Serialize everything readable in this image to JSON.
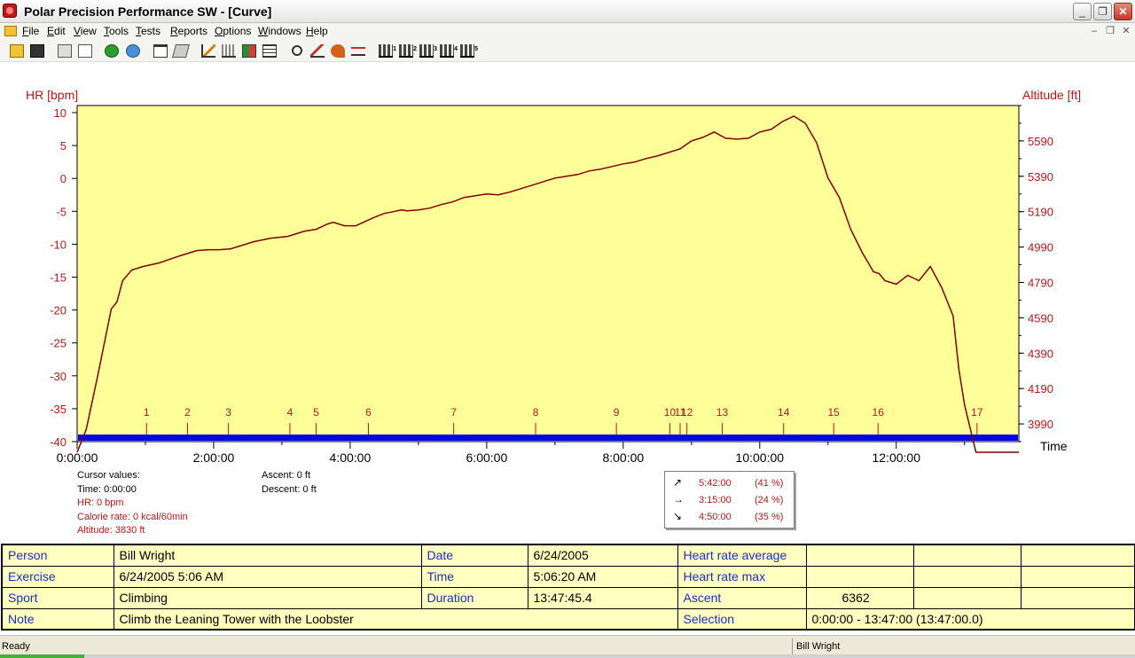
{
  "window": {
    "title": "Polar Precision Performance SW - [Curve]",
    "buttons": {
      "minimize": "_",
      "restore": "❐",
      "close": "✕"
    }
  },
  "menu": {
    "items": [
      "File",
      "Edit",
      "View",
      "Tools",
      "Tests",
      "Reports",
      "Options",
      "Windows",
      "Help"
    ],
    "mdi": {
      "minimize": "–",
      "restore": "❐",
      "close": "✕"
    }
  },
  "toolbar": {
    "icons": [
      "open-icon",
      "save-icon",
      "print-icon",
      "copy-icon",
      "refresh-icon",
      "globe-icon",
      "window-icon",
      "book-icon",
      "curve-icon",
      "bars-icon",
      "mixed-chart-icon",
      "table-icon",
      "zoom-icon",
      "chart-icon",
      "arrow-icon",
      "wave-icon",
      "bar-chart-1-icon",
      "bar-chart-2-icon",
      "bar-chart-3-icon",
      "bar-chart-4-icon",
      "bar-chart-5-icon"
    ],
    "bar_numbers": [
      "1",
      "2",
      "3",
      "4",
      "5"
    ]
  },
  "chart_data": {
    "type": "line",
    "left_axis_title": "HR [bpm]",
    "right_axis_title": "Altitude [ft]",
    "x_axis_title": "Time",
    "left_ticks": [
      "10",
      "5",
      "0",
      "-5",
      "-10",
      "-15",
      "-20",
      "-25",
      "-30",
      "-35",
      "-40"
    ],
    "right_ticks": [
      "5590",
      "5390",
      "5190",
      "4990",
      "4790",
      "4590",
      "4390",
      "4190",
      "3990"
    ],
    "x_ticks": [
      "0:00:00",
      "2:00:00",
      "4:00:00",
      "6:00:00",
      "8:00:00",
      "10:00:00",
      "12:00:00"
    ],
    "xlim_minutes": [
      0,
      827.75
    ],
    "altitude_ylim_ft": [
      3890,
      5790
    ],
    "background_color": "#ffff99",
    "line_color": "#800000",
    "series": [
      {
        "minutes": [
          0,
          8,
          18,
          30,
          35,
          40,
          48,
          58,
          72,
          90,
          105,
          115,
          125,
          135,
          145,
          155,
          170,
          185,
          200,
          210,
          220,
          225,
          230,
          235,
          245,
          255,
          262,
          270,
          278,
          285,
          290,
          300,
          310,
          320,
          330,
          340,
          350,
          360,
          370,
          380,
          390,
          400,
          410,
          420,
          430,
          440,
          450,
          460,
          470,
          480,
          490,
          500,
          510,
          520,
          530,
          540,
          550,
          560,
          570,
          580,
          590,
          600,
          610,
          620,
          630,
          640,
          650,
          660,
          670,
          680,
          690,
          700,
          705,
          710,
          720,
          730,
          740,
          750,
          760,
          770,
          775,
          780,
          790,
          800,
          810,
          820,
          827.75
        ],
        "values": [
          3830,
          3960,
          4260,
          4640,
          4680,
          4800,
          4860,
          4880,
          4900,
          4940,
          4970,
          4975,
          4975,
          4980,
          5000,
          5020,
          5040,
          5050,
          5080,
          5090,
          5120,
          5130,
          5120,
          5110,
          5110,
          5140,
          5160,
          5180,
          5190,
          5200,
          5195,
          5200,
          5210,
          5230,
          5245,
          5270,
          5280,
          5290,
          5285,
          5300,
          5320,
          5340,
          5360,
          5380,
          5390,
          5400,
          5420,
          5430,
          5445,
          5460,
          5470,
          5490,
          5505,
          5525,
          5545,
          5590,
          5610,
          5640,
          5605,
          5600,
          5605,
          5640,
          5655,
          5700,
          5730,
          5690,
          5580,
          5380,
          5270,
          5090,
          4960,
          4850,
          4840,
          4800,
          4780,
          4830,
          4800,
          4880,
          4760,
          4600,
          4300,
          4100,
          3830,
          3830,
          3830,
          3830,
          3830
        ]
      }
    ],
    "lap_markers": [
      {
        "label": "1",
        "minute": 61
      },
      {
        "label": "2",
        "minute": 97
      },
      {
        "label": "3",
        "minute": 133
      },
      {
        "label": "4",
        "minute": 187
      },
      {
        "label": "5",
        "minute": 210
      },
      {
        "label": "6",
        "minute": 256
      },
      {
        "label": "7",
        "minute": 331
      },
      {
        "label": "8",
        "minute": 403
      },
      {
        "label": "9",
        "minute": 474
      },
      {
        "label": "10",
        "minute": 521
      },
      {
        "label": "11",
        "minute": 530
      },
      {
        "label": "12",
        "minute": 536
      },
      {
        "label": "13",
        "minute": 567
      },
      {
        "label": "14",
        "minute": 621
      },
      {
        "label": "15",
        "minute": 665
      },
      {
        "label": "16",
        "minute": 704
      },
      {
        "label": "17",
        "minute": 791
      }
    ]
  },
  "cursor": {
    "heading": "Cursor values:",
    "time": "Time: 0:00:00",
    "hr": "HR: 0 bpm",
    "calorie": "Calorie rate: 0 kcal/60min",
    "altitude": "Altitude: 3830 ft",
    "ascent": "Ascent: 0 ft",
    "descent": "Descent: 0 ft"
  },
  "summary": [
    {
      "icon": "↗",
      "time": "5:42:00",
      "pct": "(41 %)"
    },
    {
      "icon": "→",
      "time": "3:15:00",
      "pct": "(24 %)"
    },
    {
      "icon": "↘",
      "time": "4:50:00",
      "pct": "(35 %)"
    }
  ],
  "info": {
    "person_label": "Person",
    "person": "Bill Wright",
    "date_label": "Date",
    "date": "6/24/2005",
    "hr_avg_label": "Heart rate average",
    "exercise_label": "Exercise",
    "exercise": "6/24/2005 5:06 AM",
    "time_label": "Time",
    "time": "5:06:20 AM",
    "hr_max_label": "Heart rate max",
    "sport_label": "Sport",
    "sport": "Climbing",
    "duration_label": "Duration",
    "duration": "13:47:45.4",
    "ascent_label": "Ascent",
    "ascent": "6362",
    "note_label": "Note",
    "note": "Climb the Leaning Tower with the Loobster",
    "selection_label": "Selection",
    "selection": "0:00:00 - 13:47:00 (13:47:00.0)"
  },
  "status": {
    "left": "Ready",
    "right": "Bill Wright"
  }
}
